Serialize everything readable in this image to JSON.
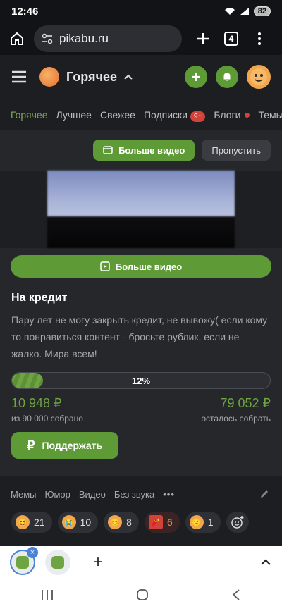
{
  "status_bar": {
    "time": "12:46",
    "battery": "82"
  },
  "browser": {
    "url": "pikabu.ru",
    "tabs_count": "4"
  },
  "app": {
    "title": "Горячее"
  },
  "nav_tabs": [
    {
      "label": "Горячее"
    },
    {
      "label": "Лучшее"
    },
    {
      "label": "Свежее"
    },
    {
      "label": "Подписки",
      "badge": "9+"
    },
    {
      "label": "Блоги"
    },
    {
      "label": "Темы"
    }
  ],
  "video_bar": {
    "more_video": "Больше видео",
    "skip": "Пропустить"
  },
  "video_full_button": "Больше видео",
  "fundraiser": {
    "title": "На кредит",
    "description": "Пару лет не могу закрыть кредит, не вывожу( если кому то понравиться контент - бросьте рублик, если не жалко. Мира всем!",
    "progress": 12,
    "progress_label": "12%",
    "collected": "10 948 ₽",
    "collected_label": "из 90 000 собрано",
    "remaining": "79 052 ₽",
    "remaining_label": "осталось собрать",
    "support_button": "Поддержать"
  },
  "tags": [
    "Мемы",
    "Юмор",
    "Видео",
    "Без звука"
  ],
  "reactions": [
    {
      "icon": "laugh-emoji-icon",
      "count": "21"
    },
    {
      "icon": "cry-emoji-icon",
      "count": "10"
    },
    {
      "icon": "smile-emoji-icon",
      "count": "8"
    },
    {
      "icon": "fire-emoji-icon",
      "count": "6"
    },
    {
      "icon": "sad-emoji-icon",
      "count": "1"
    }
  ],
  "colors": {
    "accent": "#5e9b36",
    "background": "#1c1e22",
    "card": "#25272b"
  }
}
